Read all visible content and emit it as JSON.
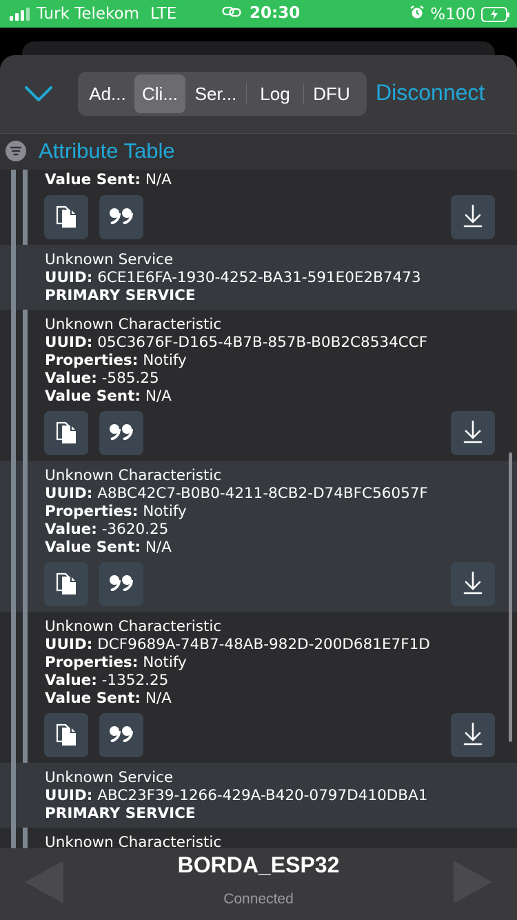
{
  "status_bar": {
    "carrier": "Turk Telekom",
    "network": "LTE",
    "time": "20:30",
    "battery": "%100"
  },
  "toolbar": {
    "tabs": [
      {
        "label": "Ad...",
        "selected": false
      },
      {
        "label": "Cli...",
        "selected": true
      },
      {
        "label": "Ser...",
        "selected": false
      },
      {
        "label": "Log",
        "selected": false
      },
      {
        "label": "DFU",
        "selected": false
      }
    ],
    "disconnect_label": "Disconnect"
  },
  "attribute_table": {
    "title": "Attribute Table",
    "labels": {
      "uuid": "UUID:",
      "properties": "Properties:",
      "value": "Value:",
      "value_sent": "Value Sent:"
    },
    "partial_top": {
      "value_sent": "N/A"
    },
    "service_1": {
      "name": "Unknown Service",
      "uuid": "6CE1E6FA-1930-4252-BA31-591E0E2B7473",
      "kind": "PRIMARY SERVICE"
    },
    "characteristics": [
      {
        "name": "Unknown Characteristic",
        "uuid": "05C3676F-D165-4B7B-857B-B0B2C8534CCF",
        "properties": "Notify",
        "value": "-585.25",
        "value_sent": "N/A"
      },
      {
        "name": "Unknown Characteristic",
        "uuid": "A8BC42C7-B0B0-4211-8CB2-D74BFC56057F",
        "properties": "Notify",
        "value": "-3620.25",
        "value_sent": "N/A"
      },
      {
        "name": "Unknown Characteristic",
        "uuid": "DCF9689A-74B7-48AB-982D-200D681E7F1D",
        "properties": "Notify",
        "value": "-1352.25",
        "value_sent": "N/A"
      }
    ],
    "service_2": {
      "name": "Unknown Service",
      "uuid": "ABC23F39-1266-429A-B420-0797D410DBA1",
      "kind": "PRIMARY SERVICE"
    },
    "partial_bottom": {
      "name": "Unknown Characteristic"
    }
  },
  "bottom_bar": {
    "device_name": "BORDA_ESP32",
    "state": "Connected"
  },
  "colors": {
    "accent": "#1fa8d8",
    "status_bar": "#33c05a"
  }
}
